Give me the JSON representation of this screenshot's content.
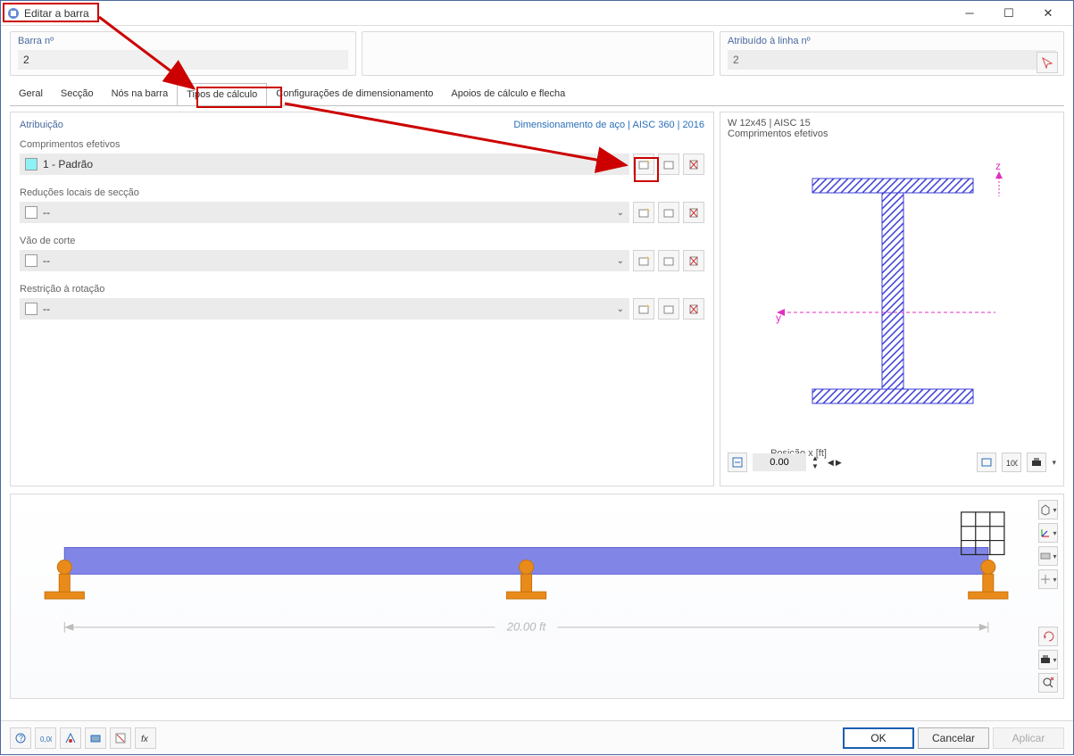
{
  "window": {
    "title": "Editar a barra"
  },
  "header": {
    "left_label": "Barra nº",
    "left_value": "2",
    "right_label": "Atribuído à linha nº",
    "right_value": "2"
  },
  "tabs": {
    "t0": "Geral",
    "t1": "Secção",
    "t2": "Nós na barra",
    "t3": "Tipos de cálculo",
    "t4": "Configurações de dimensionamento",
    "t5": "Apoios de cálculo e flecha"
  },
  "attrib": {
    "heading": "Atribuição",
    "link": "Dimensionamento de aço | AISC 360 | 2016",
    "fields": {
      "eff": {
        "label": "Comprimentos efetivos",
        "value": "1 - Padrão"
      },
      "red": {
        "label": "Reduções locais de secção",
        "value": "--"
      },
      "vao": {
        "label": "Vão de corte",
        "value": "--"
      },
      "rot": {
        "label": "Restrição à rotação",
        "value": "--"
      }
    }
  },
  "preview": {
    "title": "W 12x45 | AISC 15",
    "subtitle": "Comprimentos efetivos",
    "pos_label": "Posição x [ft]",
    "pos_value": "0.00",
    "axis_z": "z",
    "axis_y": "y"
  },
  "beam": {
    "length_label": "20.00 ft"
  },
  "footer": {
    "ok": "OK",
    "cancel": "Cancelar",
    "apply": "Aplicar"
  }
}
